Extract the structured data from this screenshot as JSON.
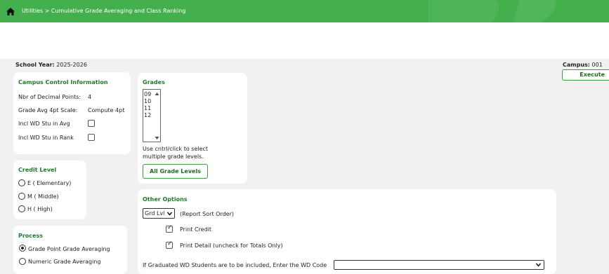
{
  "header": {
    "breadcrumb": "Utilities > Cumulative Grade Averaging and Class Ranking"
  },
  "school_year": {
    "label": "School Year:",
    "value": "2025-2026"
  },
  "campus": {
    "label": "Campus:",
    "value": "001"
  },
  "execute_label": "Execute",
  "campus_control": {
    "title": "Campus Control Information",
    "decimal_label": "Nbr of Decimal Points:",
    "decimal_value": "4",
    "scale_label": "Grade Avg 4pt Scale:",
    "scale_value": "Compute 4pt",
    "incl_avg_label": "Incl WD Stu in Avg",
    "incl_rank_label": "Incl WD Stu in Rank"
  },
  "grades": {
    "title": "Grades",
    "options": [
      "09",
      "10",
      "11",
      "12"
    ],
    "hint_line1": "Use cntrl/click to select",
    "hint_line2": "multiple grade levels.",
    "all_button": "All Grade Levels"
  },
  "credit_level": {
    "title": "Credit Level",
    "options": [
      "E ( Elementary)",
      "M ( Middle)",
      "H ( High)"
    ]
  },
  "process": {
    "title": "Process",
    "options": [
      "Grade Point Grade Averaging",
      "Numeric Grade Averaging"
    ],
    "selected": "Grade Point Grade Averaging"
  },
  "other_options": {
    "title": "Other Options",
    "sort_value": "Grd Lvl",
    "sort_label": "(Report Sort Order)",
    "print_credit_label": "Print Credit",
    "print_detail_label": "Print Detail (uncheck for Totals Only)",
    "wd_code_label": "If Graduated WD Students are to be included, Enter the WD Code",
    "wd_code_value": ""
  },
  "colors": {
    "header_green": "#44b04d",
    "title_green": "#1f7a2a",
    "background": "#f1f1f1"
  }
}
